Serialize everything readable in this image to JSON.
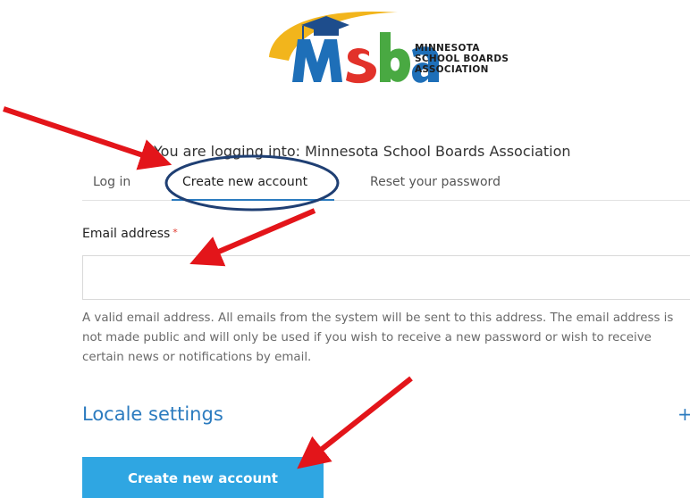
{
  "logo": {
    "letters": "MSbA",
    "lines": [
      "MINNESOTA",
      "SCHOOL BOARDS",
      "ASSOCIATION"
    ],
    "colors": {
      "swoosh": "#f2b51c",
      "blue": "#1e6fb8",
      "red": "#e2322a",
      "green": "#49a942",
      "cap": "#1e4d8c"
    }
  },
  "intro": {
    "text": "You are logging into: Minnesota School Boards Association"
  },
  "tabs": [
    {
      "label": "Log in",
      "active": false
    },
    {
      "label": "Create new account",
      "active": true
    },
    {
      "label": "Reset your password",
      "active": false
    }
  ],
  "form": {
    "email_label": "Email address",
    "required_mark": "*",
    "email_value": "",
    "email_placeholder": "",
    "help_text": "A valid email address. All emails from the system will be sent to this address. The email address is not made public and will only be used if you wish to receive a new password or wish to receive certain news or notifications by email."
  },
  "locale": {
    "title": "Locale settings",
    "toggle": "+"
  },
  "submit": {
    "label": "Create new account"
  },
  "annotations": {
    "arrow_color": "#e3151a",
    "ellipse_color": "#1f3f73"
  }
}
